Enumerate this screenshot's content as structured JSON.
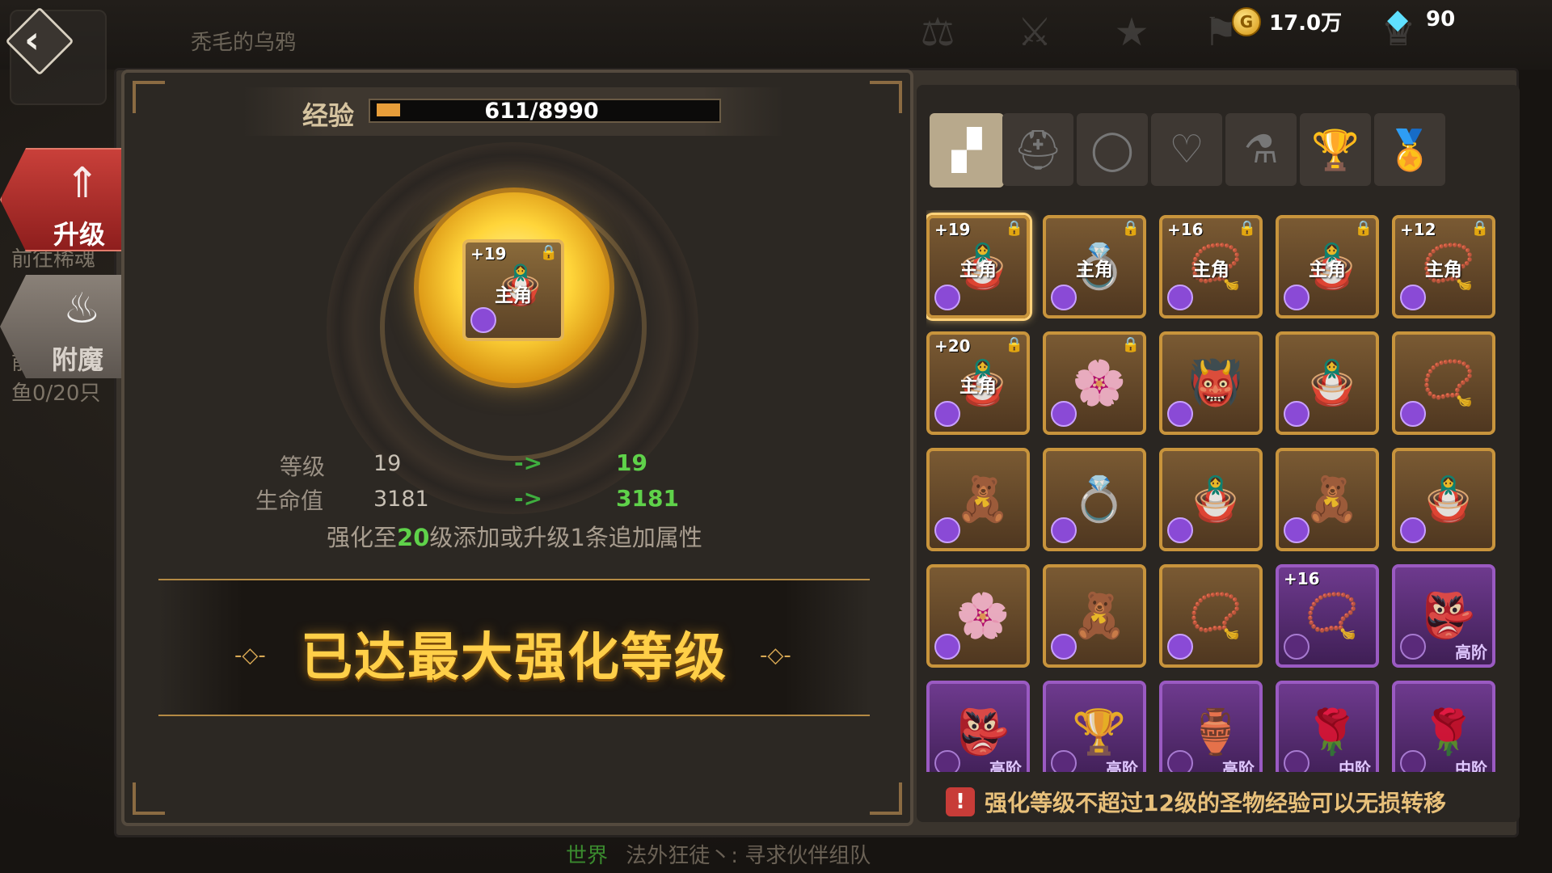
{
  "header": {
    "player_name": "秃毛的乌鸦",
    "gold": "17.0万",
    "gems": "90",
    "coin_symbol": "G"
  },
  "side_tabs": [
    {
      "label": "升级",
      "active": true
    },
    {
      "label": "附魔",
      "active": false
    }
  ],
  "background_text": {
    "line1": "前往稀魂",
    "line2": "前往",
    "line3": "鱼0/20只"
  },
  "upgrade": {
    "exp_label": "经验",
    "exp_text": "611/8990",
    "exp_progress": 0.068,
    "center_item": {
      "plus": "+19",
      "owner": "主角"
    },
    "stats": [
      {
        "label": "等级",
        "current": "19",
        "arrow": "->",
        "next": "19"
      },
      {
        "label": "生命值",
        "current": "3181",
        "arrow": "->",
        "next": "3181"
      }
    ],
    "hint_prefix": "强化至",
    "hint_level": "20",
    "hint_suffix": "级添加或升级1条追加属性",
    "max_banner": "已达最大强化等级"
  },
  "filter_tabs": [
    "all-icon",
    "helmet-icon",
    "ring-icon",
    "necklace-icon",
    "potion-icon",
    "trophy-icon",
    "medal-icon"
  ],
  "items": [
    {
      "plus": "+19",
      "lock": true,
      "owner": "主角",
      "rarity": "gold",
      "selected": true,
      "tier": ""
    },
    {
      "plus": "",
      "lock": true,
      "owner": "主角",
      "rarity": "gold",
      "selected": false,
      "tier": ""
    },
    {
      "plus": "+16",
      "lock": true,
      "owner": "主角",
      "rarity": "gold",
      "selected": false,
      "tier": ""
    },
    {
      "plus": "",
      "lock": true,
      "owner": "主角",
      "rarity": "gold",
      "selected": false,
      "tier": ""
    },
    {
      "plus": "+12",
      "lock": true,
      "owner": "主角",
      "rarity": "gold",
      "selected": false,
      "tier": ""
    },
    {
      "plus": "+20",
      "lock": true,
      "owner": "主角",
      "rarity": "gold",
      "selected": false,
      "tier": ""
    },
    {
      "plus": "",
      "lock": true,
      "owner": "",
      "rarity": "gold",
      "selected": false,
      "tier": ""
    },
    {
      "plus": "",
      "lock": false,
      "owner": "",
      "rarity": "gold",
      "selected": false,
      "tier": ""
    },
    {
      "plus": "",
      "lock": false,
      "owner": "",
      "rarity": "gold",
      "selected": false,
      "tier": ""
    },
    {
      "plus": "",
      "lock": false,
      "owner": "",
      "rarity": "gold",
      "selected": false,
      "tier": ""
    },
    {
      "plus": "",
      "lock": false,
      "owner": "",
      "rarity": "gold",
      "selected": false,
      "tier": ""
    },
    {
      "plus": "",
      "lock": false,
      "owner": "",
      "rarity": "gold",
      "selected": false,
      "tier": ""
    },
    {
      "plus": "",
      "lock": false,
      "owner": "",
      "rarity": "gold",
      "selected": false,
      "tier": ""
    },
    {
      "plus": "",
      "lock": false,
      "owner": "",
      "rarity": "gold",
      "selected": false,
      "tier": ""
    },
    {
      "plus": "",
      "lock": false,
      "owner": "",
      "rarity": "gold",
      "selected": false,
      "tier": ""
    },
    {
      "plus": "",
      "lock": false,
      "owner": "",
      "rarity": "gold",
      "selected": false,
      "tier": ""
    },
    {
      "plus": "",
      "lock": false,
      "owner": "",
      "rarity": "gold",
      "selected": false,
      "tier": ""
    },
    {
      "plus": "",
      "lock": false,
      "owner": "",
      "rarity": "gold",
      "selected": false,
      "tier": ""
    },
    {
      "plus": "+16",
      "lock": false,
      "owner": "",
      "rarity": "purple",
      "selected": false,
      "tier": ""
    },
    {
      "plus": "",
      "lock": false,
      "owner": "",
      "rarity": "purple",
      "selected": false,
      "tier": "高阶"
    },
    {
      "plus": "",
      "lock": false,
      "owner": "",
      "rarity": "purple",
      "selected": false,
      "tier": "高阶"
    },
    {
      "plus": "",
      "lock": false,
      "owner": "",
      "rarity": "purple",
      "selected": false,
      "tier": "高阶"
    },
    {
      "plus": "",
      "lock": false,
      "owner": "",
      "rarity": "purple",
      "selected": false,
      "tier": "高阶"
    },
    {
      "plus": "",
      "lock": false,
      "owner": "",
      "rarity": "purple",
      "selected": false,
      "tier": "中阶"
    },
    {
      "plus": "",
      "lock": false,
      "owner": "",
      "rarity": "purple",
      "selected": false,
      "tier": "中阶"
    }
  ],
  "warning": "强化等级不超过12级的圣物经验可以无损转移",
  "chat": {
    "channel": "世界",
    "message": "法外狂徒丶: 寻求伙伴组队"
  }
}
